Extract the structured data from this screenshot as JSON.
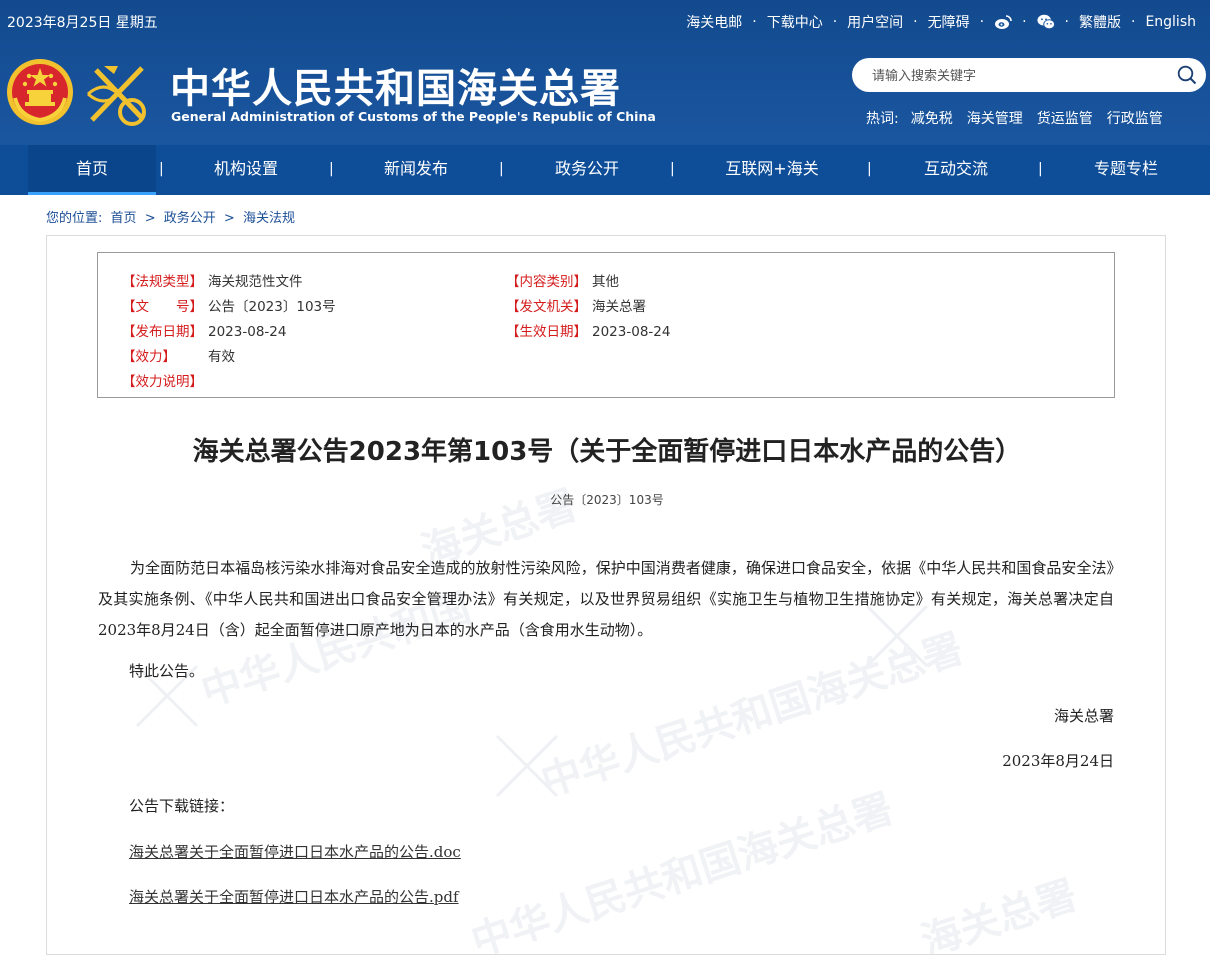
{
  "header": {
    "date": "2023年8月25日 星期五",
    "top_links": [
      "海关电邮",
      "下载中心",
      "用户空间",
      "无障碍"
    ],
    "social_icons": [
      "weibo-icon",
      "wechat-icon"
    ],
    "lang_links": [
      "繁體版",
      "English"
    ],
    "title": "中华人民共和国海关总署",
    "subtitle": "General Administration of Customs of the People's Republic of China",
    "search": {
      "placeholder": "请输入搜索关键字"
    },
    "hot_label": "热词:",
    "hot_words": [
      "减免税",
      "海关管理",
      "货运监管",
      "行政监管"
    ]
  },
  "nav": {
    "items": [
      "首页",
      "机构设置",
      "新闻发布",
      "政务公开",
      "互联网+海关",
      "互动交流",
      "专题专栏"
    ],
    "active": "首页",
    "separator": "|"
  },
  "breadcrumb": {
    "label": "您的位置:",
    "items": [
      "首页",
      "政务公开",
      "海关法规"
    ],
    "separator": ">"
  },
  "meta": {
    "law_type_key": "【法规类型】",
    "law_type": "海关规范性文件",
    "content_type_key": "【内容类别】",
    "content_type": "其他",
    "doc_no_key": "【文　　号】",
    "doc_no": "公告〔2023〕103号",
    "issuer_key": "【发文机关】",
    "issuer": "海关总署",
    "pub_date_key": "【发布日期】",
    "pub_date": "2023-08-24",
    "eff_date_key": "【生效日期】",
    "eff_date": "2023-08-24",
    "validity_key": "【效力】",
    "validity": "有效",
    "validity_note_key": "【效力说明】"
  },
  "document": {
    "title": "海关总署公告2023年第103号（关于全面暂停进口日本水产品的公告）",
    "number": "公告〔2023〕103号",
    "body": "为全面防范日本福岛核污染水排海对食品安全造成的放射性污染风险，保护中国消费者健康，确保进口食品安全，依据《中华人民共和国食品安全法》及其实施条例、《中华人民共和国进出口食品安全管理办法》有关规定，以及世界贸易组织《实施卫生与植物卫生措施协定》有关规定，海关总署决定自2023年8月24日（含）起全面暂停进口原产地为日本的水产品（含食用水生动物）。",
    "closing": "特此公告。",
    "signatory": "海关总署",
    "sign_date": "2023年8月24日",
    "download_label": "公告下载链接：",
    "downloads": [
      "海关总署关于全面暂停进口日本水产品的公告.doc",
      "海关总署关于全面暂停进口日本水产品的公告.pdf"
    ]
  },
  "colors": {
    "header_bg": "#1a56a0",
    "nav_bg": "#0e4d98",
    "meta_key": "#d41c1c",
    "breadcrumb": "#1c4f96"
  }
}
